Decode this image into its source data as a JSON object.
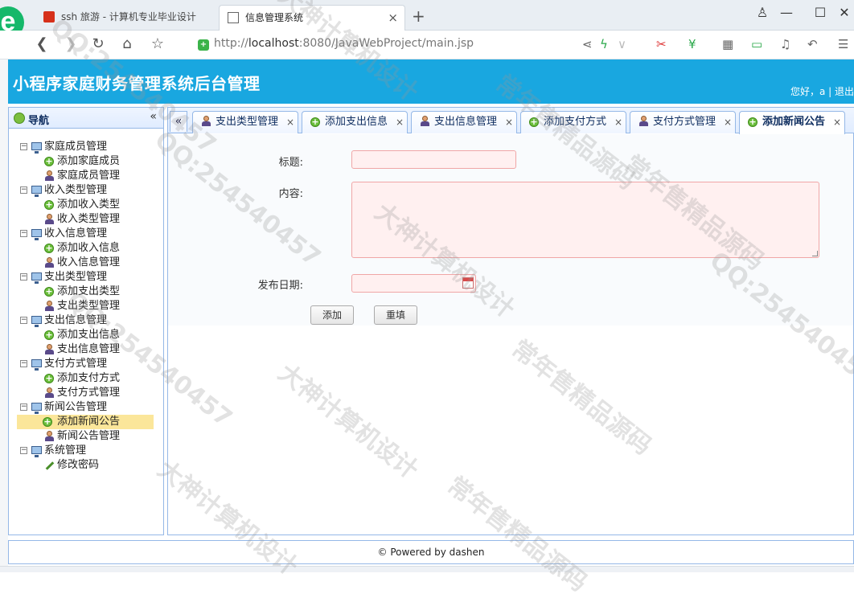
{
  "browser": {
    "tabs": [
      {
        "title": "ssh 旅游 - 计算机专业毕业设计",
        "active": false
      },
      {
        "title": "信息管理系统",
        "active": true
      }
    ],
    "url_prefix": "http://",
    "url_host": "localhost",
    "url_rest": ":8080/JavaWebProject/main.jsp",
    "colors": {
      "tab_bg": "#e9eef3",
      "logo": "#15b86a"
    }
  },
  "header": {
    "title": "小程序家庭财务管理系统后台管理",
    "greeting": "您好，a | 退出",
    "color": "#19a7e0"
  },
  "sidebar": {
    "title": "导航",
    "groups": [
      {
        "label": "家庭成员管理",
        "items": [
          {
            "label": "添加家庭成员",
            "icon": "add-icon"
          },
          {
            "label": "家庭成员管理",
            "icon": "user-icon"
          }
        ]
      },
      {
        "label": "收入类型管理",
        "items": [
          {
            "label": "添加收入类型",
            "icon": "add-icon"
          },
          {
            "label": "收入类型管理",
            "icon": "user-icon"
          }
        ]
      },
      {
        "label": "收入信息管理",
        "items": [
          {
            "label": "添加收入信息",
            "icon": "add-icon"
          },
          {
            "label": "收入信息管理",
            "icon": "user-icon"
          }
        ]
      },
      {
        "label": "支出类型管理",
        "items": [
          {
            "label": "添加支出类型",
            "icon": "add-icon"
          },
          {
            "label": "支出类型管理",
            "icon": "user-icon"
          }
        ]
      },
      {
        "label": "支出信息管理",
        "items": [
          {
            "label": "添加支出信息",
            "icon": "add-icon"
          },
          {
            "label": "支出信息管理",
            "icon": "user-icon"
          }
        ]
      },
      {
        "label": "支付方式管理",
        "items": [
          {
            "label": "添加支付方式",
            "icon": "add-icon"
          },
          {
            "label": "支付方式管理",
            "icon": "user-icon"
          }
        ]
      },
      {
        "label": "新闻公告管理",
        "items": [
          {
            "label": "添加新闻公告",
            "icon": "add-icon",
            "selected": true
          },
          {
            "label": "新闻公告管理",
            "icon": "user-icon"
          }
        ]
      },
      {
        "label": "系统管理",
        "items": [
          {
            "label": "修改密码",
            "icon": "pencil-icon"
          }
        ]
      }
    ]
  },
  "content_tabs": [
    {
      "label": "支出类型管理",
      "icon": "user-icon"
    },
    {
      "label": "添加支出信息",
      "icon": "add-icon"
    },
    {
      "label": "支出信息管理",
      "icon": "user-icon"
    },
    {
      "label": "添加支付方式",
      "icon": "add-icon"
    },
    {
      "label": "支付方式管理",
      "icon": "user-icon"
    },
    {
      "label": "添加新闻公告",
      "icon": "add-icon",
      "active": true
    }
  ],
  "form": {
    "title_label": "标题:",
    "title_value": "",
    "content_label": "内容:",
    "content_value": "",
    "date_label": "发布日期:",
    "date_value": "",
    "add_button": "添加",
    "reset_button": "重填"
  },
  "footer": {
    "text": "© Powered by dashen"
  },
  "watermark": {
    "lines": [
      "QQ:254540457",
      "大神计算机设计",
      "常年售精品源码"
    ]
  }
}
